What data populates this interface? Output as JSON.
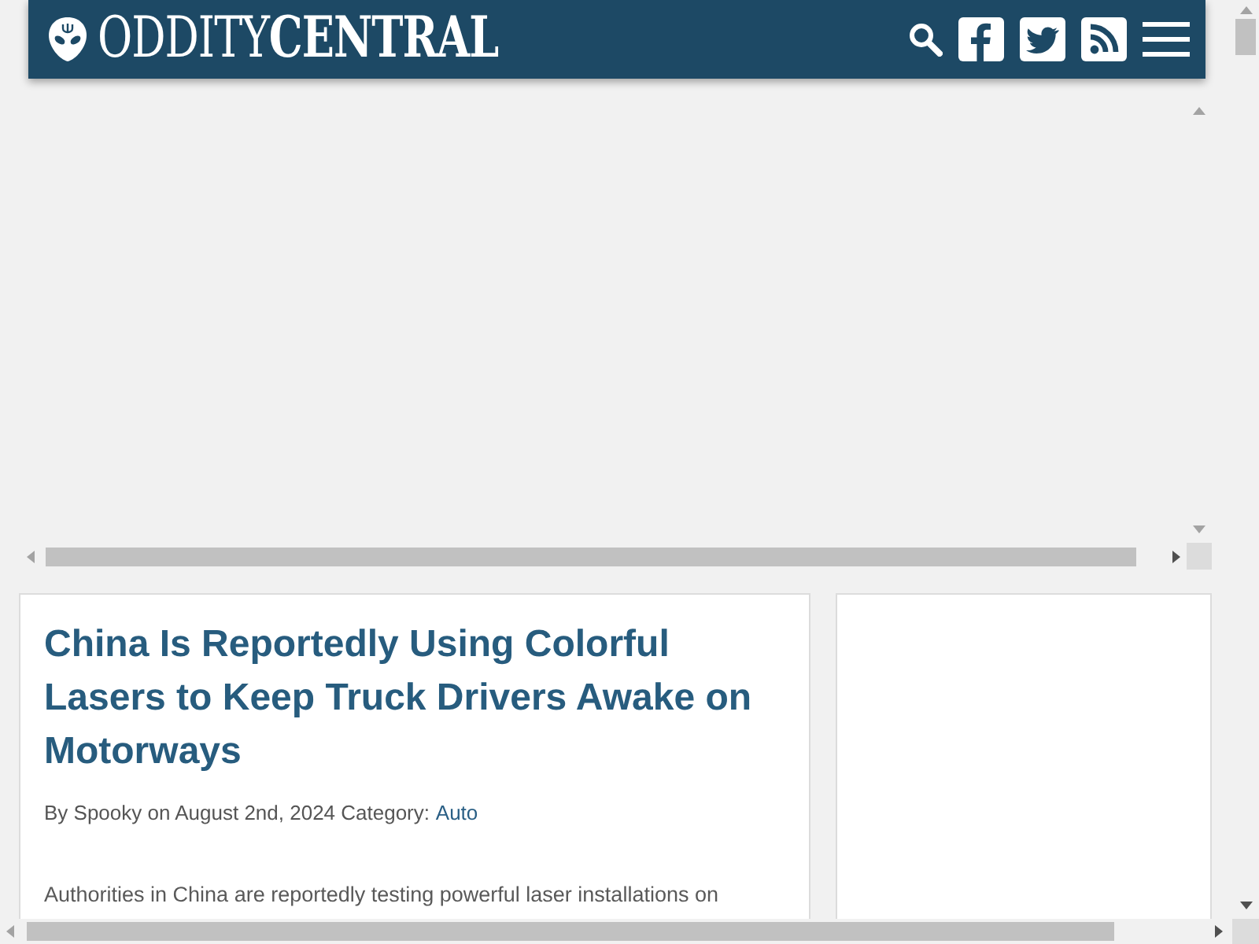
{
  "header": {
    "logo": "ODDITY**CENTRAL**"
  },
  "article": {
    "title": "China Is Reportedly Using Colorful Lasers to Keep Truck Drivers Awake on Motorways",
    "byline": "By Spooky on August 2nd, 2024 Category:",
    "category": "Auto",
    "body": "Authorities in China are reportedly testing powerful laser installations on"
  }
}
